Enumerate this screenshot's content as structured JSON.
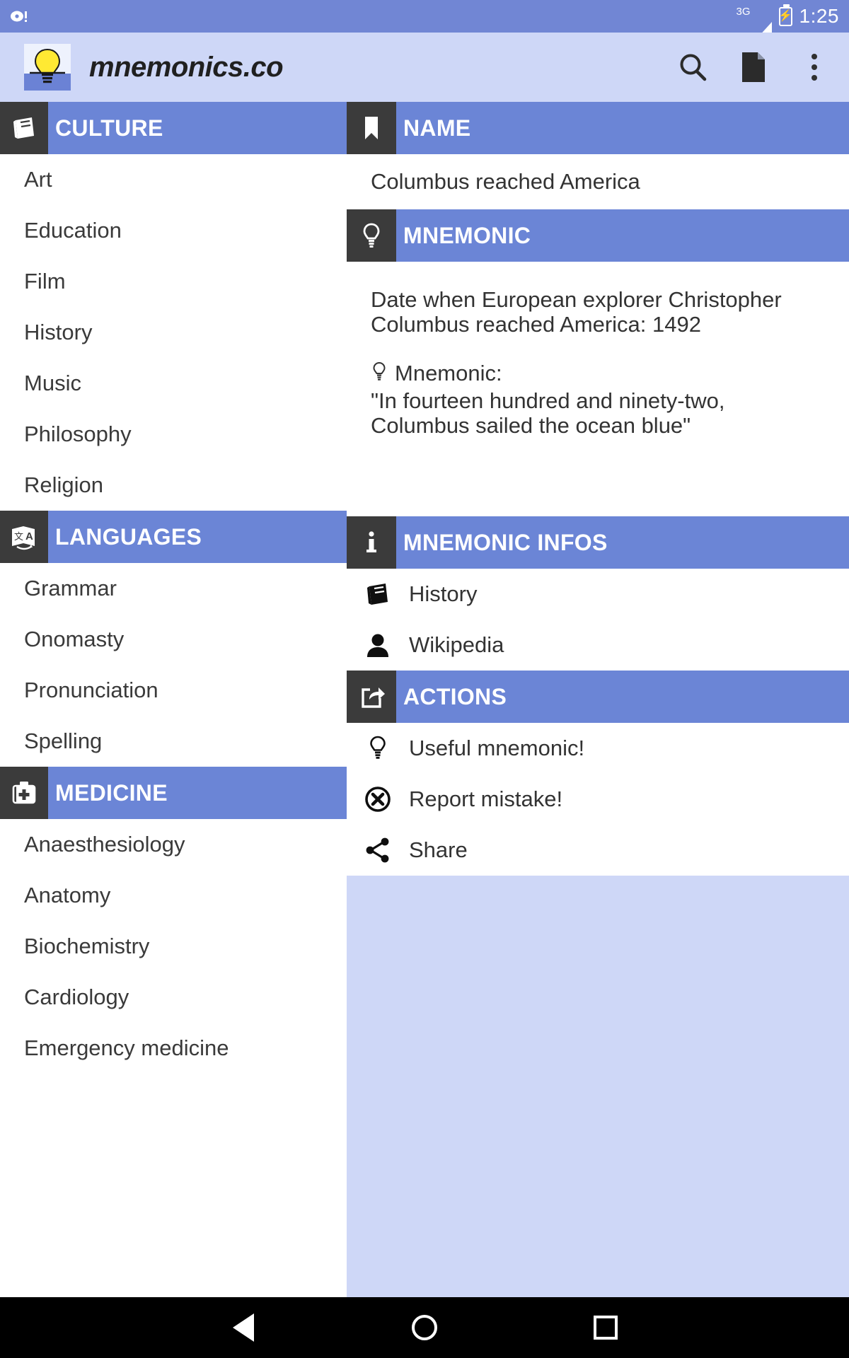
{
  "statusbar": {
    "network_label": "3G",
    "time": "1:25",
    "icons": [
      "record-icon",
      "signal-icon",
      "battery-icon"
    ]
  },
  "appbar": {
    "title": "mnemonics.co",
    "logo_icon": "lightbulb-logo",
    "actions": [
      {
        "name": "search-icon",
        "label": "Search"
      },
      {
        "name": "document-icon",
        "label": "Document"
      },
      {
        "name": "overflow-menu-icon",
        "label": "More options"
      }
    ]
  },
  "colors": {
    "accent_blue": "#6b85d6",
    "statusbar_blue": "#7186d4",
    "appbar_lavender": "#ced7f7",
    "chip_dark": "#3b3b3b",
    "bulb_yellow": "#ffe933"
  },
  "sidebar": {
    "sections": [
      {
        "title": "CULTURE",
        "icon": "book-icon",
        "items": [
          "Art",
          "Education",
          "Film",
          "History",
          "Music",
          "Philosophy",
          "Religion"
        ]
      },
      {
        "title": "LANGUAGES",
        "icon": "translate-icon",
        "items": [
          "Grammar",
          "Onomasty",
          "Pronunciation",
          "Spelling"
        ]
      },
      {
        "title": "MEDICINE",
        "icon": "medical-bag-icon",
        "items": [
          "Anaesthesiology",
          "Anatomy",
          "Biochemistry",
          "Cardiology",
          "Emergency medicine"
        ]
      }
    ]
  },
  "detail": {
    "name_section": {
      "title": "NAME",
      "icon": "bookmark-icon",
      "value": "Columbus reached America"
    },
    "mnemonic_section": {
      "title": "MNEMONIC",
      "icon": "lightbulb-outline-icon",
      "description": "Date when European explorer Christopher Columbus reached America: 1492",
      "label": "Mnemonic:",
      "label_icon": "lightbulb-small-icon",
      "quote": "\"In fourteen hundred and ninety-two, Columbus sailed the ocean blue\""
    },
    "infos_section": {
      "title": "MNEMONIC INFOS",
      "icon": "info-icon",
      "items": [
        {
          "label": "History",
          "icon": "book-icon"
        },
        {
          "label": "Wikipedia",
          "icon": "person-icon"
        }
      ]
    },
    "actions_section": {
      "title": "ACTIONS",
      "icon": "share-export-icon",
      "items": [
        {
          "label": "Useful mnemonic!",
          "icon": "lightbulb-outline-icon"
        },
        {
          "label": "Report mistake!",
          "icon": "error-circle-icon"
        },
        {
          "label": "Share",
          "icon": "share-nodes-icon"
        }
      ]
    }
  },
  "navbar": {
    "buttons": [
      {
        "name": "back-button",
        "icon": "triangle-back-icon"
      },
      {
        "name": "home-button",
        "icon": "circle-home-icon"
      },
      {
        "name": "recents-button",
        "icon": "square-recents-icon"
      }
    ]
  }
}
